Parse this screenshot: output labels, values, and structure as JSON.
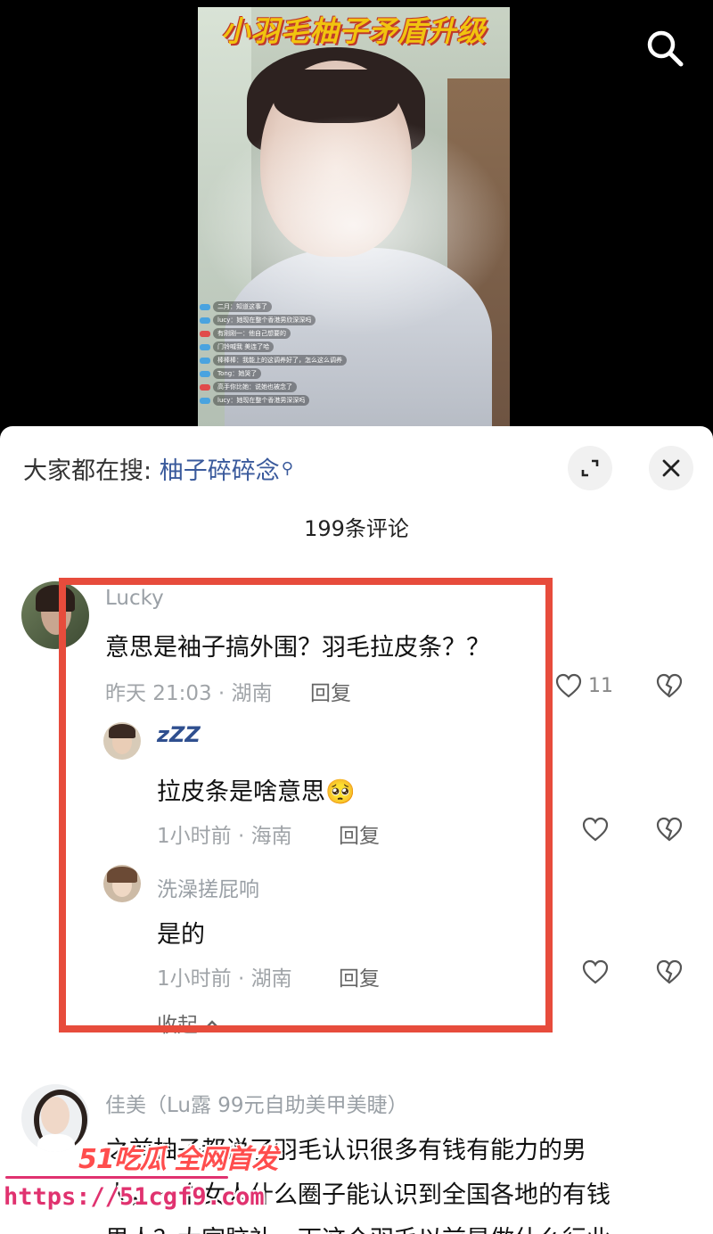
{
  "video": {
    "title": "小羽毛柚子矛盾升级",
    "live_comments": [
      "二月：知道这事了",
      "lucy：她现在整个香港男欣深深吗",
      "有刚刚一：他自己想要的",
      "门铃喊我 美连了哈",
      "棒棒棒：我能上的这调养好了，怎么这么调养",
      "Tong：她哭了",
      "高手你比她：说她也被念了",
      "lucy：她现在整个香港男深深吗"
    ]
  },
  "search": {
    "prefix": "大家都在搜:",
    "keyword": "柚子碎碎念"
  },
  "comments_header": "199条评论",
  "comments": [
    {
      "username": "Lucky",
      "text": "意思是袖子搞外围？羽毛拉皮条？？",
      "time": "昨天 21:03",
      "location": "湖南",
      "meta": "昨天 21:03 · 湖南",
      "reply_label": "回复",
      "likes": "11",
      "replies": [
        {
          "username": "zZZ",
          "text": "拉皮条是啥意思🥺",
          "meta": "1小时前 · 海南",
          "reply_label": "回复"
        },
        {
          "username": "洗澡搓屁响",
          "text": "是的",
          "meta": "1小时前 · 湖南",
          "reply_label": "回复"
        }
      ],
      "collapse_label": "收起"
    },
    {
      "username": "佳美（Lu露 99元自助美甲美睫）",
      "text_line1": "之前柚子都说了羽毛认识很多有钱有能力的男",
      "text_line2": "人，一个女人什么圈子能认识到全国各地的有钱",
      "text_line3": "男人？大家脑补一下这个羽毛以前是做什么行业"
    }
  ],
  "watermark": {
    "brand": "51吃瓜 全网首发",
    "url": "https://51cgf9.com"
  },
  "colors": {
    "highlight": "#e74c3c",
    "link": "#3a5a9c",
    "watermark": "#ff4d4d"
  },
  "icons": [
    "search-icon",
    "expand-icon",
    "close-icon",
    "like-icon",
    "dislike-icon",
    "chevron-up-icon"
  ]
}
